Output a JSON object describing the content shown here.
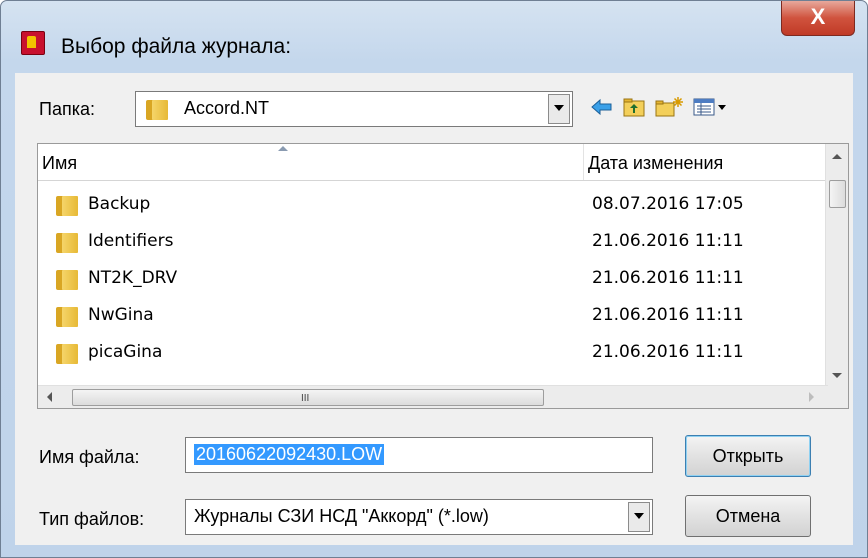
{
  "dialog": {
    "title": "Выбор файла журнала:",
    "close_label": "X"
  },
  "folder": {
    "label": "Папка:",
    "value": "Accord.NT"
  },
  "toolbar": {
    "back_icon": "back-arrow-icon",
    "up_icon": "up-folder-icon",
    "new_folder_icon": "new-folder-icon",
    "view_menu_icon": "view-menu-icon"
  },
  "list": {
    "columns": {
      "name": "Имя",
      "date": "Дата изменения"
    },
    "rows": [
      {
        "name": "Backup",
        "date": "08.07.2016 17:05"
      },
      {
        "name": "Identifiers",
        "date": "21.06.2016 11:11"
      },
      {
        "name": "NT2K_DRV",
        "date": "21.06.2016 11:11"
      },
      {
        "name": "NwGina",
        "date": "21.06.2016 11:11"
      },
      {
        "name": "picaGina",
        "date": "21.06.2016 11:11"
      }
    ],
    "hscroll_grip": "III"
  },
  "filename": {
    "label": "Имя файла:",
    "value": "20160622092430.LOW"
  },
  "filetype": {
    "label": "Тип файлов:",
    "value": "Журналы СЗИ НСД \"Аккорд\" (*.low)"
  },
  "buttons": {
    "open": "Открыть",
    "cancel": "Отмена"
  }
}
